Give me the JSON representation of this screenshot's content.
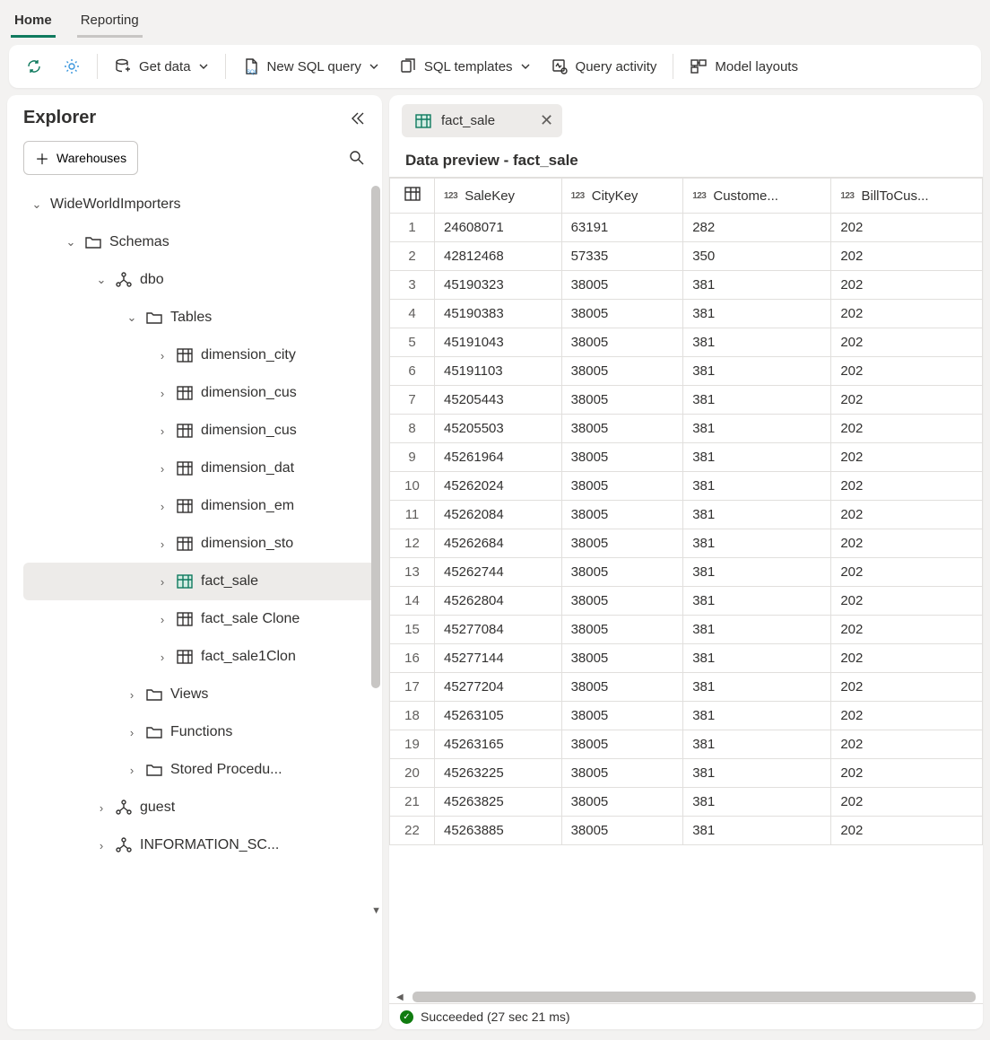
{
  "tabs": {
    "home": "Home",
    "reporting": "Reporting"
  },
  "toolbar": {
    "get_data": "Get data",
    "new_sql": "New SQL query",
    "sql_templates": "SQL templates",
    "query_activity": "Query activity",
    "model_layouts": "Model layouts"
  },
  "explorer": {
    "title": "Explorer",
    "warehouses_btn": "Warehouses",
    "tree": {
      "db": "WideWorldImporters",
      "schemas": "Schemas",
      "dbo": "dbo",
      "tables_label": "Tables",
      "tables": [
        "dimension_city",
        "dimension_cus",
        "dimension_cus",
        "dimension_dat",
        "dimension_em",
        "dimension_sto",
        "fact_sale",
        "fact_sale Clone",
        "fact_sale1Clon"
      ],
      "views": "Views",
      "functions": "Functions",
      "storedproc": "Stored Procedu...",
      "guest": "guest",
      "info_schema": "INFORMATION_SC..."
    }
  },
  "content": {
    "tab_name": "fact_sale",
    "preview_title": "Data preview - fact_sale",
    "columns": [
      {
        "name": "SaleKey",
        "type": "123"
      },
      {
        "name": "CityKey",
        "type": "123"
      },
      {
        "name": "Custome...",
        "type": "123"
      },
      {
        "name": "BillToCus...",
        "type": "123"
      }
    ],
    "rows": [
      [
        24608071,
        63191,
        282,
        202
      ],
      [
        42812468,
        57335,
        350,
        202
      ],
      [
        45190323,
        38005,
        381,
        202
      ],
      [
        45190383,
        38005,
        381,
        202
      ],
      [
        45191043,
        38005,
        381,
        202
      ],
      [
        45191103,
        38005,
        381,
        202
      ],
      [
        45205443,
        38005,
        381,
        202
      ],
      [
        45205503,
        38005,
        381,
        202
      ],
      [
        45261964,
        38005,
        381,
        202
      ],
      [
        45262024,
        38005,
        381,
        202
      ],
      [
        45262084,
        38005,
        381,
        202
      ],
      [
        45262684,
        38005,
        381,
        202
      ],
      [
        45262744,
        38005,
        381,
        202
      ],
      [
        45262804,
        38005,
        381,
        202
      ],
      [
        45277084,
        38005,
        381,
        202
      ],
      [
        45277144,
        38005,
        381,
        202
      ],
      [
        45277204,
        38005,
        381,
        202
      ],
      [
        45263105,
        38005,
        381,
        202
      ],
      [
        45263165,
        38005,
        381,
        202
      ],
      [
        45263225,
        38005,
        381,
        202
      ],
      [
        45263825,
        38005,
        381,
        202
      ],
      [
        45263885,
        38005,
        381,
        202
      ]
    ]
  },
  "status": {
    "text": "Succeeded (27 sec 21 ms)"
  }
}
